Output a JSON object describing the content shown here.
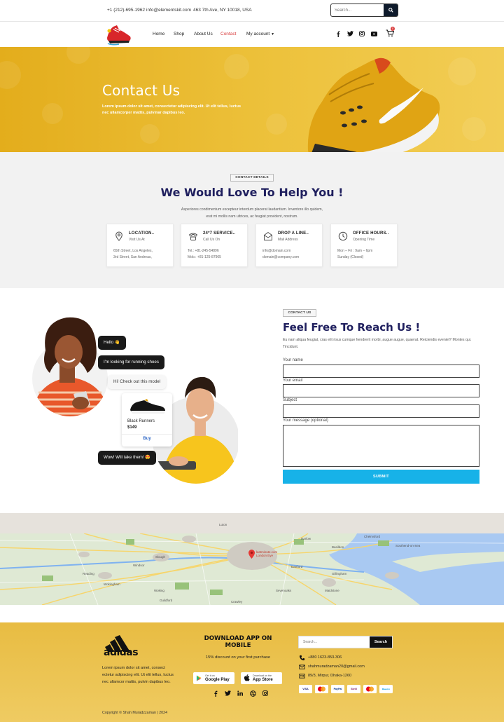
{
  "topbar": {
    "phone": "+1 (212)-695-1962",
    "email": "info@elementskit.com",
    "address": "463 7th Ave, NY 10018, USA",
    "search_placeholder": "Search..."
  },
  "nav": {
    "links": [
      {
        "label": "Home"
      },
      {
        "label": "Shop"
      },
      {
        "label": "About Us"
      },
      {
        "label": "Contact"
      },
      {
        "label": "My account"
      }
    ],
    "active": "Contact",
    "cart_count": "0",
    "social_icons": [
      "facebook-icon",
      "twitter-icon",
      "instagram-icon",
      "youtube-icon"
    ]
  },
  "hero": {
    "title": "Contact Us",
    "text": "Lorem ipsum dolor sit amet, consectetur adipiscing elit. Ut elit tellus, luctus nec ullamcorper mattis, pulvinar dapibus leo."
  },
  "details": {
    "tag": "CONTACT DETAILS",
    "heading": "We Would Love To Help You !",
    "subtext": "Asperiores condimentum excepteur interdum placerat laudantium. Inventore illo quidem, erat mi mollis nam ultrices, ac feugiat provident, nostrum.",
    "cards": [
      {
        "icon": "location-pin-icon",
        "title": "LOCATION..",
        "subtitle": "Visit Us At",
        "line1": "65th Street, Los Angeles,",
        "line2": "3rd Street, San Andreas,"
      },
      {
        "icon": "phone-icon",
        "title": "24*7 SERVICE..",
        "subtitle": "Call Us On",
        "line1": "Tel.: +81-245-54896",
        "line2": "Mob.: +81-125-87965"
      },
      {
        "icon": "envelope-icon",
        "title": "DROP A LINE..",
        "subtitle": "Mail Address",
        "line1": "info@domain.com",
        "line2": "domain@company.com"
      },
      {
        "icon": "clock-icon",
        "title": "OFFICE HOURS..",
        "subtitle": "Opening Time",
        "line1": "Mon – Fri : 9am – 6pm",
        "line2": "Sunday (Closed)"
      }
    ]
  },
  "chat": {
    "bubbles": [
      "Hello 👋",
      "I'm looking for running shoes",
      "Hi! Check out this model",
      "Wow! Will take them! 😍"
    ],
    "product_name": "Black Runners",
    "product_price": "$149",
    "buy_label": "Buy"
  },
  "reach": {
    "tag": "CONTACT US",
    "heading": "Feel Free To Reach Us !",
    "text": "Eu nam aliqua feugiat, cras elit risus cumque hendrerit morbi, augue augue, quaerat. Reiciendis eveniet? Montes qui. Tincidunt.",
    "fields": {
      "name_label": "Your name",
      "email_label": "Your email",
      "subject_label": "Subject",
      "message_label": "Your message (optional)"
    },
    "submit_label": "SUBMIT"
  },
  "map": {
    "pin_label": "lastminute.com London Eye",
    "places": [
      "Luton",
      "Harlow",
      "Chelmsford",
      "Southend-on-Sea",
      "Slough",
      "Reading",
      "Wokingham",
      "Woking",
      "Guildford",
      "Crawley",
      "Maidstone",
      "Gillingham",
      "Sevenoaks",
      "Basildon",
      "Windsor",
      "Dartford"
    ]
  },
  "footer": {
    "brand": "adidas",
    "text": "Lorem ipsum dolor sit amet, consect ectetur adipiscing elit. Ut elit tellus, luctus nec ullamcor mattis, pulvin dapibus leo.",
    "app_heading": "DOWNLOAD APP ON MOBILE",
    "discount": "15% discount on your first purchase",
    "stores": [
      {
        "small": "Get it on",
        "big": "Google Play",
        "icon": "google-play-icon"
      },
      {
        "small": "Download on the",
        "big": "App Store",
        "icon": "apple-icon"
      }
    ],
    "search_placeholder": "Search...",
    "search_button": "Search",
    "phone": "+880 1623-853-306",
    "email": "shahmuradzaman20@gmail.com",
    "address": "89/3, Mirpur, Dhaka-1260",
    "payments": [
      "VISA",
      "MC",
      "PayPal",
      "Skrill",
      "MC",
      "Maestro"
    ],
    "social_icons": [
      "facebook-icon",
      "twitter-icon",
      "linkedin-icon",
      "dribbble-icon",
      "instagram-icon"
    ],
    "copyright": "Copyright © Shah Muradzzaman | 2024"
  },
  "colors": {
    "accent_yellow": "#edc23c",
    "heading_navy": "#1f1f5e",
    "submit_blue": "#17b2e8",
    "nav_active": "#d94040"
  }
}
